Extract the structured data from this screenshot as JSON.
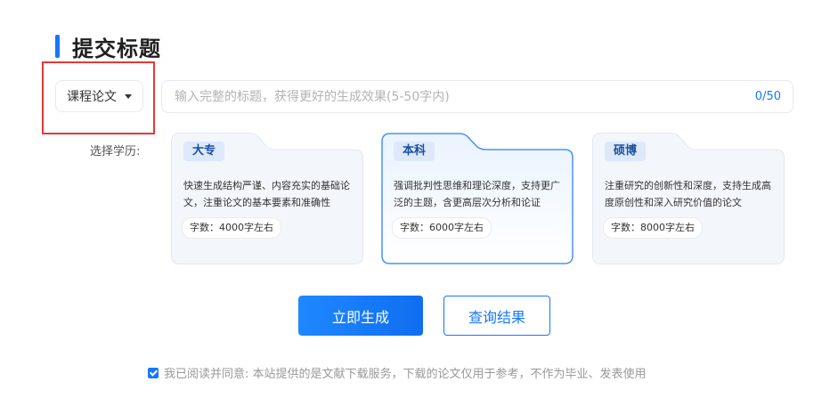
{
  "section_title": "提交标题",
  "paper_type_dropdown": {
    "selected": "课程论文"
  },
  "title_input": {
    "value": "",
    "placeholder": "输入完整的标题，获得更好的生成效果(5-50字内)",
    "char_count": "0/50"
  },
  "education": {
    "label": "选择学历:",
    "selected": "本科",
    "options": [
      {
        "tag": "大专",
        "description": "快速生成结构严谨、内容充实的基础论文，注重论文的基本要素和准确性",
        "word_count": "字数：4000字左右"
      },
      {
        "tag": "本科",
        "description": "强调批判性思维和理论深度，支持更广泛的主题，含更高层次分析和论证",
        "word_count": "字数：6000字左右"
      },
      {
        "tag": "硕博",
        "description": "注重研究的创新性和深度，支持生成高度原创性和深入研究价值的论文",
        "word_count": "字数：8000字左右"
      }
    ]
  },
  "actions": {
    "generate_label": "立即生成",
    "query_label": "查询结果"
  },
  "agreement": {
    "checked": true,
    "text": "我已阅读并同意: 本站提供的是文献下载服务，下载的论文仅用于参考，不作为毕业、发表使用"
  },
  "colors": {
    "accent": "#1677ff",
    "highlight_border": "#e53935",
    "card_bg": "#f3f6fa",
    "card_selected_border": "#4a93f7"
  },
  "icons": {
    "dropdown": "caret-down-icon",
    "checkbox": "checkbox-checked-icon"
  }
}
